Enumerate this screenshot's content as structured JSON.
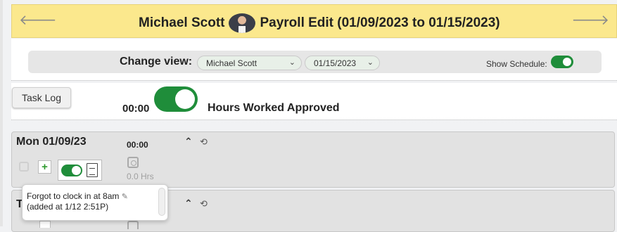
{
  "header": {
    "employee_name": "Michael Scott",
    "page_title": "Payroll Edit (01/09/2023 to 01/15/2023)",
    "prev_icon": "arrow-left-icon",
    "next_icon": "arrow-right-icon"
  },
  "view_bar": {
    "label": "Change view:",
    "employee_select": "Michael Scott",
    "date_select": "01/15/2023",
    "show_schedule_label": "Show Schedule:",
    "show_schedule_on": true
  },
  "approval": {
    "task_log_label": "Task Log",
    "total_time": "00:00",
    "approved": true,
    "approved_label": "Hours Worked Approved"
  },
  "days": [
    {
      "label": "Mon 01/09/23",
      "time": "00:00",
      "hours": "0.0 Hrs",
      "add_icon": "+",
      "approved": true
    },
    {
      "label": "T"
    }
  ],
  "tooltip": {
    "line1": "Forgot to clock in at 8am",
    "line2": "(added at 1/12 2:51P)"
  },
  "colors": {
    "header_bg": "#fbe88d",
    "toggle_on": "#1f8d3a",
    "panel_bg": "#e2e2e2"
  }
}
